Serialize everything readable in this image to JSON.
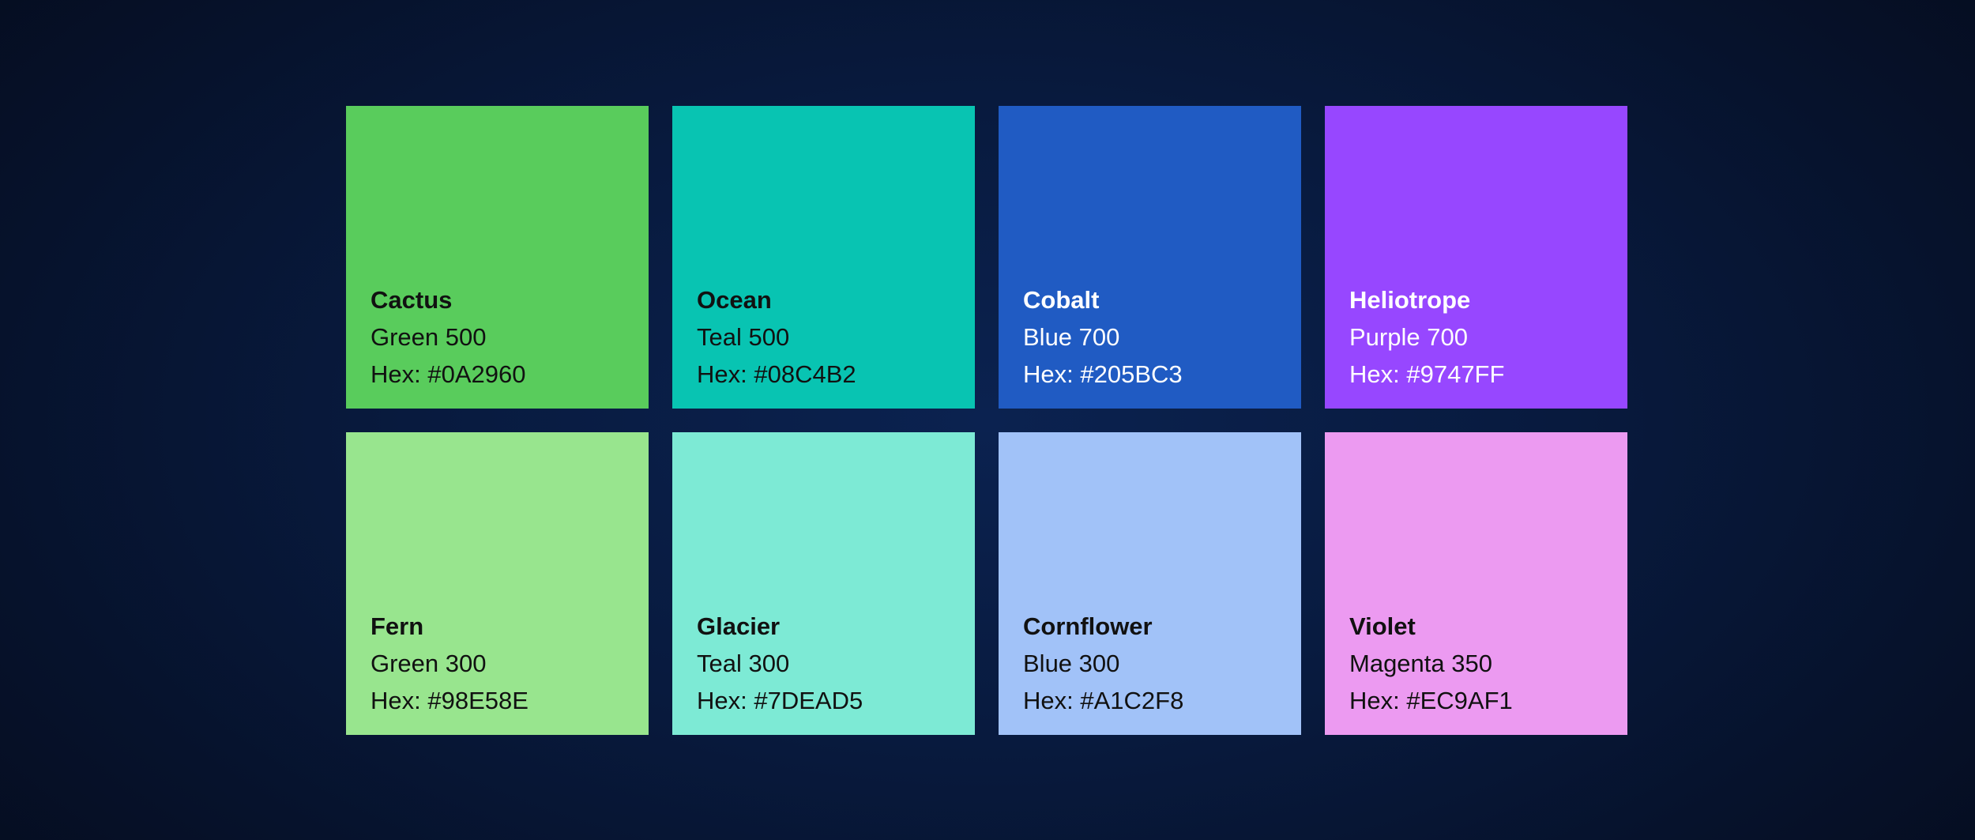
{
  "swatches": [
    {
      "name": "Cactus",
      "shade": "Green 500",
      "hex": "Hex: #0A2960",
      "color": "#59CC5C",
      "text": "dark"
    },
    {
      "name": "Ocean",
      "shade": "Teal 500",
      "hex": "Hex: #08C4B2",
      "color": "#08C4B2",
      "text": "dark"
    },
    {
      "name": "Cobalt",
      "shade": "Blue 700",
      "hex": "Hex: #205BC3",
      "color": "#205BC3",
      "text": "light"
    },
    {
      "name": "Heliotrope",
      "shade": "Purple 700",
      "hex": "Hex: #9747FF",
      "color": "#9747FF",
      "text": "light"
    },
    {
      "name": "Fern",
      "shade": "Green 300",
      "hex": "Hex: #98E58E",
      "color": "#98E58E",
      "text": "dark"
    },
    {
      "name": "Glacier",
      "shade": "Teal 300",
      "hex": "Hex: #7DEAD5",
      "color": "#7DEAD5",
      "text": "dark"
    },
    {
      "name": "Cornflower",
      "shade": "Blue 300",
      "hex": "Hex: #A1C2F8",
      "color": "#A1C2F8",
      "text": "dark"
    },
    {
      "name": "Violet",
      "shade": "Magenta 350",
      "hex": "Hex: #EC9AF1",
      "color": "#EC9AF1",
      "text": "dark"
    }
  ]
}
